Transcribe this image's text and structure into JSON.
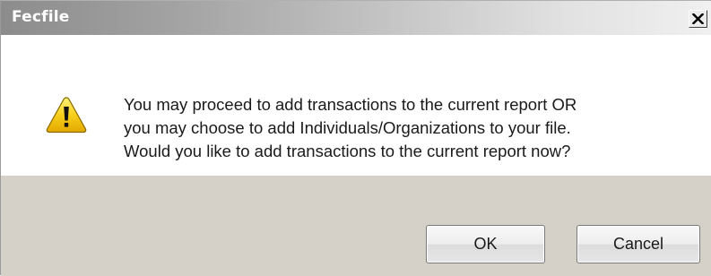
{
  "window": {
    "title": "Fecfile",
    "close_icon": "close-icon"
  },
  "dialog": {
    "icon": "warning-icon",
    "message_lines": [
      "You may proceed to add transactions to the current report OR",
      "you may choose to add Individuals/Organizations to your file.",
      "Would you like to add transactions to the current report now?"
    ]
  },
  "buttons": {
    "ok_label": "OK",
    "cancel_label": "Cancel"
  },
  "colors": {
    "footer_background": "#d5d0c8",
    "warning_yellow": "#f5c400"
  }
}
